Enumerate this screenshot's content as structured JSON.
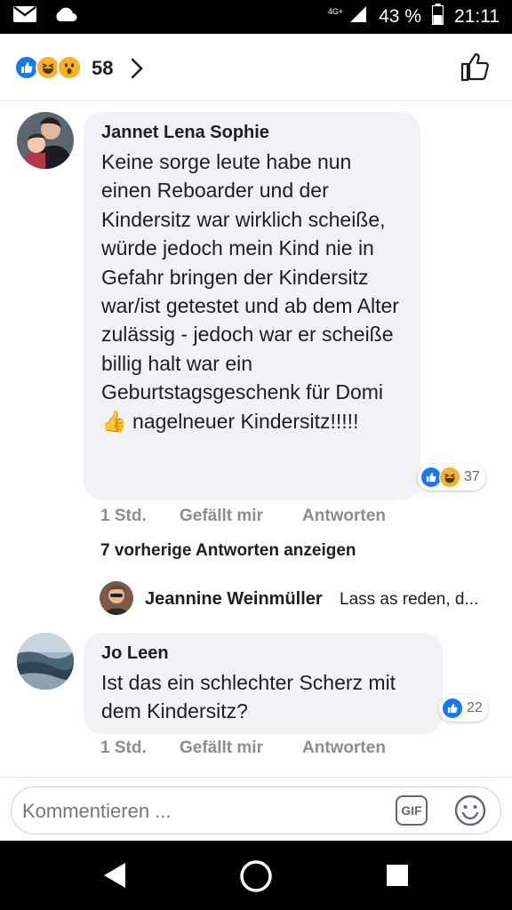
{
  "status_bar": {
    "network": "4G+",
    "battery": "43 %",
    "time": "21:11"
  },
  "reactions_header": {
    "count": "58",
    "reaction_types": [
      "like",
      "haha",
      "wow"
    ]
  },
  "comments": [
    {
      "author": "Jannet Lena Sophie",
      "text": "Keine sorge leute habe nun einen Reboarder und der Kindersitz war wirklich scheiße, würde jedoch mein Kind nie in Gefahr bringen der Kindersitz war/ist getestet und ab dem Alter zulässig - jedoch war er scheiße billig halt war ein Geburtstagsgeschenk für Domi 👍 nagelneuer Kindersitz!!!!!",
      "reaction_count": "37",
      "time": "1 Std.",
      "like_label": "Gefällt mir",
      "reply_label": "Antworten"
    },
    {
      "author": "Jo Leen",
      "text": "Ist das ein schlechter Scherz mit dem Kindersitz?",
      "reaction_count": "22",
      "time": "1 Std.",
      "like_label": "Gefällt mir",
      "reply_label": "Antworten"
    }
  ],
  "more_replies_label": "7 vorherige Antworten anzeigen",
  "reply_preview": {
    "author": "Jeannine Weinmüller",
    "text": "Lass as reden, d..."
  },
  "composer": {
    "placeholder": "Kommentieren ...",
    "gif_label": "GIF"
  },
  "colors": {
    "like_blue": "#1877f2",
    "haha_yellow": "#f7b125",
    "bubble_gray": "#f0f2f5"
  }
}
